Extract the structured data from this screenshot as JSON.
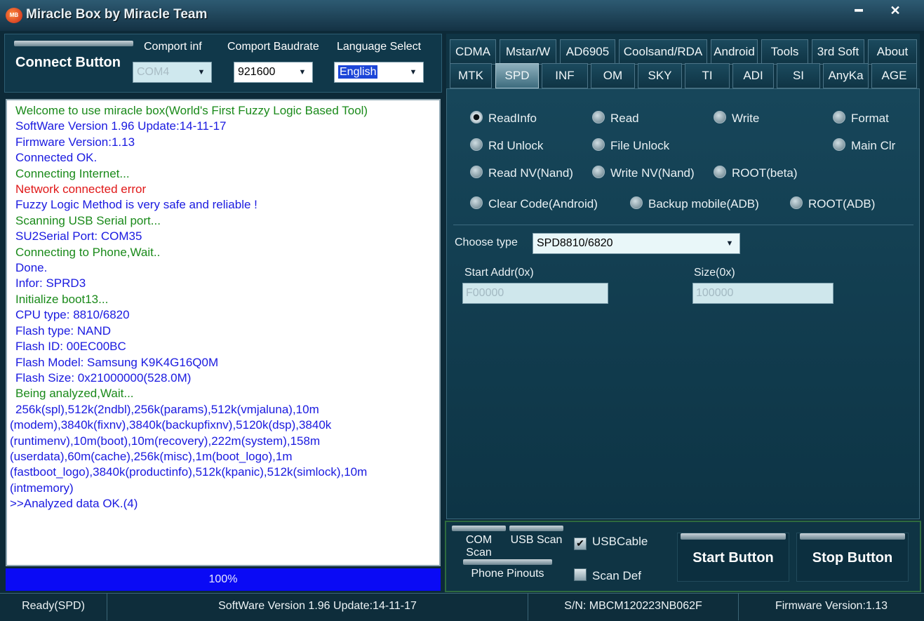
{
  "window": {
    "title": "Miracle Box by Miracle Team",
    "icon_text": "MB",
    "minimize": "━",
    "close": "✕"
  },
  "top": {
    "connect_label": "Connect Button",
    "comport_label": "Comport inf",
    "comport_value": "COM4",
    "baud_label": "Comport Baudrate",
    "baud_value": "921600",
    "lang_label": "Language Select",
    "lang_value": "English"
  },
  "log": {
    "lines": [
      {
        "text": "Welcome to use miracle box(World's First Fuzzy Logic Based Tool)",
        "color": "g"
      },
      {
        "text": "SoftWare Version 1.96  Update:14-11-17",
        "color": "b"
      },
      {
        "text": "Firmware Version:1.13",
        "color": "b"
      },
      {
        "text": "Connected OK.",
        "color": "b"
      },
      {
        "text": "Connecting Internet...",
        "color": "g"
      },
      {
        "text": "Network connected error",
        "color": "r"
      },
      {
        "text": "Fuzzy Logic Method is very safe and reliable !",
        "color": "b"
      },
      {
        "text": "Scanning USB Serial port...",
        "color": "g"
      },
      {
        "text": "SU2Serial Port: COM35",
        "color": "b"
      },
      {
        "text": "Connecting to Phone,Wait..",
        "color": "g"
      },
      {
        "text": "Done.",
        "color": "b"
      },
      {
        "text": "Infor: SPRD3",
        "color": "b"
      },
      {
        "text": "Initialize boot13...",
        "color": "g"
      },
      {
        "text": "CPU    type: 8810/6820",
        "color": "b"
      },
      {
        "text": "Flash  type: NAND",
        "color": "b"
      },
      {
        "text": "Flash    ID: 00EC00BC",
        "color": "b"
      },
      {
        "text": "Flash Model: Samsung K9K4G16Q0M",
        "color": "b"
      },
      {
        "text": "Flash  Size: 0x21000000(528.0M)",
        "color": "b"
      },
      {
        "text": "Being analyzed,Wait...",
        "color": "g"
      },
      {
        "text": " 256k(spl),512k(2ndbl),256k(params),512k(vmjaluna),10m",
        "color": "b",
        "outdent": false
      },
      {
        "text": "(modem),3840k(fixnv),3840k(backupfixnv),5120k(dsp),3840k",
        "color": "b",
        "outdent": true
      },
      {
        "text": "(runtimenv),10m(boot),10m(recovery),222m(system),158m",
        "color": "b",
        "outdent": true
      },
      {
        "text": "(userdata),60m(cache),256k(misc),1m(boot_logo),1m",
        "color": "b",
        "outdent": true
      },
      {
        "text": "(fastboot_logo),3840k(productinfo),512k(kpanic),512k(simlock),10m",
        "color": "b",
        "outdent": true
      },
      {
        "text": "(intmemory)",
        "color": "b",
        "outdent": true
      },
      {
        "text": ">>Analyzed data OK.(4)",
        "color": "b",
        "outdent": true
      }
    ]
  },
  "progress": {
    "label": "100%",
    "value": 1.0
  },
  "tabs": {
    "row1": [
      "CDMA",
      "Mstar/W",
      "AD6905",
      "Coolsand/RDA",
      "Android",
      "Tools",
      "3rd Soft",
      "About"
    ],
    "row2": [
      "MTK",
      "SPD",
      "INF",
      "OM",
      "SKY",
      "TI",
      "ADI",
      "SI",
      "AnyKa",
      "AGE"
    ],
    "active": "SPD"
  },
  "spd": {
    "options": {
      "readinfo": "ReadInfo",
      "read": "Read",
      "write": "Write",
      "format": "Format",
      "rd_unlock": "Rd Unlock",
      "file_unlock": "File Unlock",
      "main_clr": "Main Clr",
      "read_nv": "Read NV(Nand)",
      "write_nv": "Write NV(Nand)",
      "root_beta": "ROOT(beta)",
      "clear_code": "Clear Code(Android)",
      "backup_adb": "Backup mobile(ADB)",
      "root_adb": "ROOT(ADB)"
    },
    "selected": "readinfo",
    "choose_type_label": "Choose  type",
    "choose_type_value": "SPD8810/6820",
    "start_addr_label": "Start Addr(0x)",
    "start_addr_value": "F00000",
    "size_label": "Size(0x)",
    "size_value": "100000"
  },
  "controls": {
    "com_scan": "COM Scan",
    "usb_scan": "USB Scan",
    "usb_cable": "USBCable",
    "usb_cable_checked": true,
    "phone_pinouts": "Phone Pinouts",
    "scan_def": "Scan Def",
    "scan_def_checked": false,
    "start": "Start Button",
    "stop": "Stop Button"
  },
  "status": {
    "state": "Ready(SPD)",
    "software": "SoftWare Version 1.96  Update:14-11-17",
    "serial": "S/N: MBCM120223NB062F",
    "firmware": "Firmware Version:1.13"
  }
}
